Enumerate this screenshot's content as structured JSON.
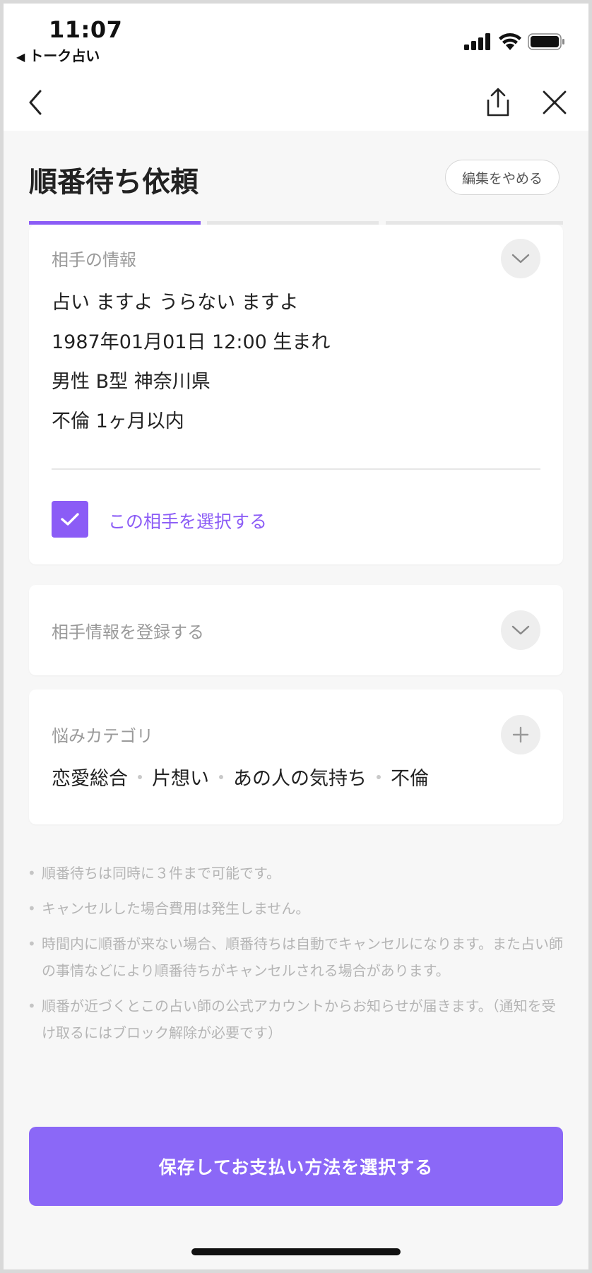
{
  "status_bar": {
    "time": "11:07",
    "back_app": "トーク占い",
    "back_glyph": "◀"
  },
  "nav": {
    "back_icon": "chevron-left-icon",
    "share_icon": "share-icon",
    "close_icon": "close-icon"
  },
  "header": {
    "title": "順番待ち依頼",
    "stop_edit": "編集をやめる"
  },
  "progress": {
    "steps_total": 3,
    "current_step": 1
  },
  "partner_card": {
    "label": "相手の情報",
    "lines": [
      "占い ますよ うらない ますよ",
      "1987年01月01日 12:00 生まれ",
      "男性 B型 神奈川県",
      "不倫 1ヶ月以内"
    ],
    "select_label": "この相手を選択する",
    "selected": true
  },
  "register_card": {
    "label": "相手情報を登録する"
  },
  "category_card": {
    "label": "悩みカテゴリ",
    "tags": [
      "恋愛総合",
      "片想い",
      "あの人の気持ち",
      "不倫"
    ]
  },
  "notes": [
    "順番待ちは同時に３件まで可能です。",
    "キャンセルした場合費用は発生しません。",
    "時間内に順番が来ない場合、順番待ちは自動でキャンセルになります。また占い師の事情などにより順番待ちがキャンセルされる場合があります。",
    "順番が近づくとこの占い師の公式アカウントからお知らせが届きます。（通知を受け取るにはブロック解除が必要です）"
  ],
  "cta": {
    "label": "保存してお支払い方法を選択する"
  },
  "colors": {
    "accent": "#8b5cf6",
    "cta": "#8b68f7"
  }
}
